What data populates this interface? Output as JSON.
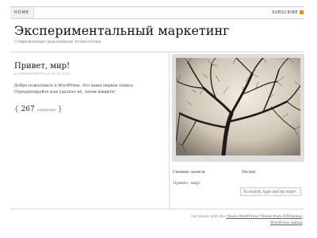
{
  "nav": {
    "home_label": "HOME",
    "subscribe_label": "SUBSCRIBE"
  },
  "site": {
    "title": "Экспериментальный маркетинг",
    "description": "Современные рекламные технологии"
  },
  "post": {
    "title": "Привет, мир!",
    "meta": "by ADMINISTRATOR on 09.02.2010",
    "body": "Добро пожаловать в WordPress. Это ваша первая запись. Отредактируйте или удалите её, затем пишите!",
    "comments_count": "267",
    "comments_label": "comments"
  },
  "sidebar": {
    "recent_heading": "Свежие записи",
    "recent_items": [
      "Привет, мир!"
    ],
    "meta_heading": "Метки",
    "search_placeholder": "To search, type and hit enter"
  },
  "footer": {
    "line1_text": "Get smart with the ",
    "line1_link": "Thesis WordPress Theme from DIYthemes",
    "line1_end": ".",
    "line2_link": "WordPress Admin",
    "line2_end": "."
  },
  "colors": {
    "rss": "#f08c1c",
    "link": "#2a5db0"
  }
}
